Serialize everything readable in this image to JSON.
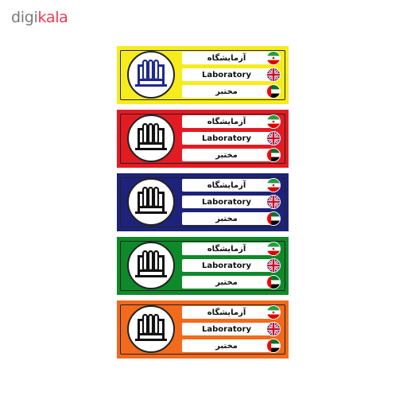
{
  "brand": {
    "part1": "digi",
    "part2": "kala"
  },
  "labels": {
    "persian": "آزمایشگاه",
    "english": "Laboratory",
    "arabic": "مختبر"
  },
  "flags": [
    "iran-flag-icon",
    "uk-flag-icon",
    "uae-flag-icon"
  ],
  "signs": [
    {
      "color": "#f6ec1d",
      "icon_color": "#1e2a8a"
    },
    {
      "color": "#e31b23",
      "icon_color": "#111111"
    },
    {
      "color": "#1d237a",
      "icon_color": "#111111"
    },
    {
      "color": "#0f8a2a",
      "icon_color": "#111111"
    },
    {
      "color": "#f26a1b",
      "icon_color": "#111111"
    }
  ]
}
